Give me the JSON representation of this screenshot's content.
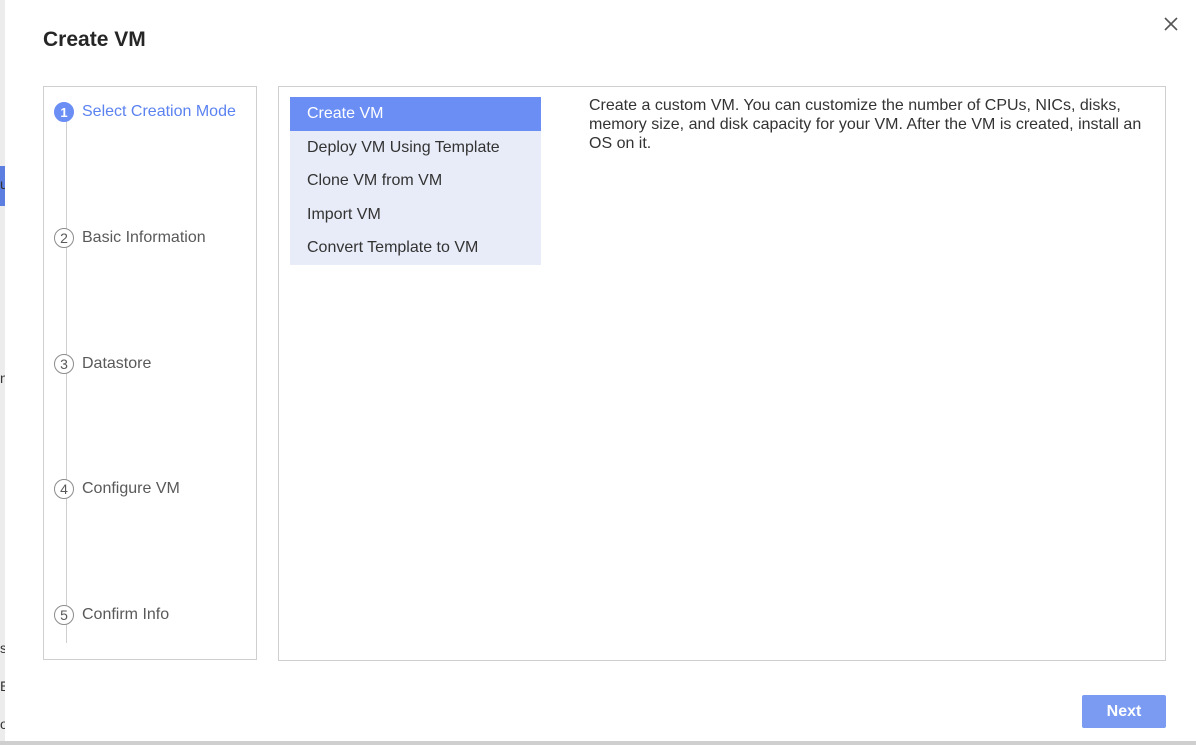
{
  "background": {
    "fragments": [
      "u",
      "n",
      "s",
      "E",
      "o"
    ]
  },
  "dialog": {
    "title": "Create VM"
  },
  "steps": [
    {
      "number": "1",
      "label": "Select Creation Mode",
      "active": true
    },
    {
      "number": "2",
      "label": "Basic Information",
      "active": false
    },
    {
      "number": "3",
      "label": "Datastore",
      "active": false
    },
    {
      "number": "4",
      "label": "Configure VM",
      "active": false
    },
    {
      "number": "5",
      "label": "Confirm Info",
      "active": false
    }
  ],
  "modes": [
    {
      "label": "Create VM",
      "selected": true
    },
    {
      "label": "Deploy VM Using Template",
      "selected": false
    },
    {
      "label": "Clone VM from VM",
      "selected": false
    },
    {
      "label": "Import VM",
      "selected": false
    },
    {
      "label": "Convert Template to VM",
      "selected": false
    }
  ],
  "description": "Create a custom VM. You can customize the number of CPUs, NICs, disks, memory size, and disk capacity for your VM. After the VM is created, install an OS on it.",
  "footer": {
    "next_label": "Next"
  },
  "colors": {
    "accent": "#6b8ef5",
    "accent_text": "#5b82f0",
    "list_bg": "#e8ecf8",
    "button": "#7b9bf3"
  }
}
